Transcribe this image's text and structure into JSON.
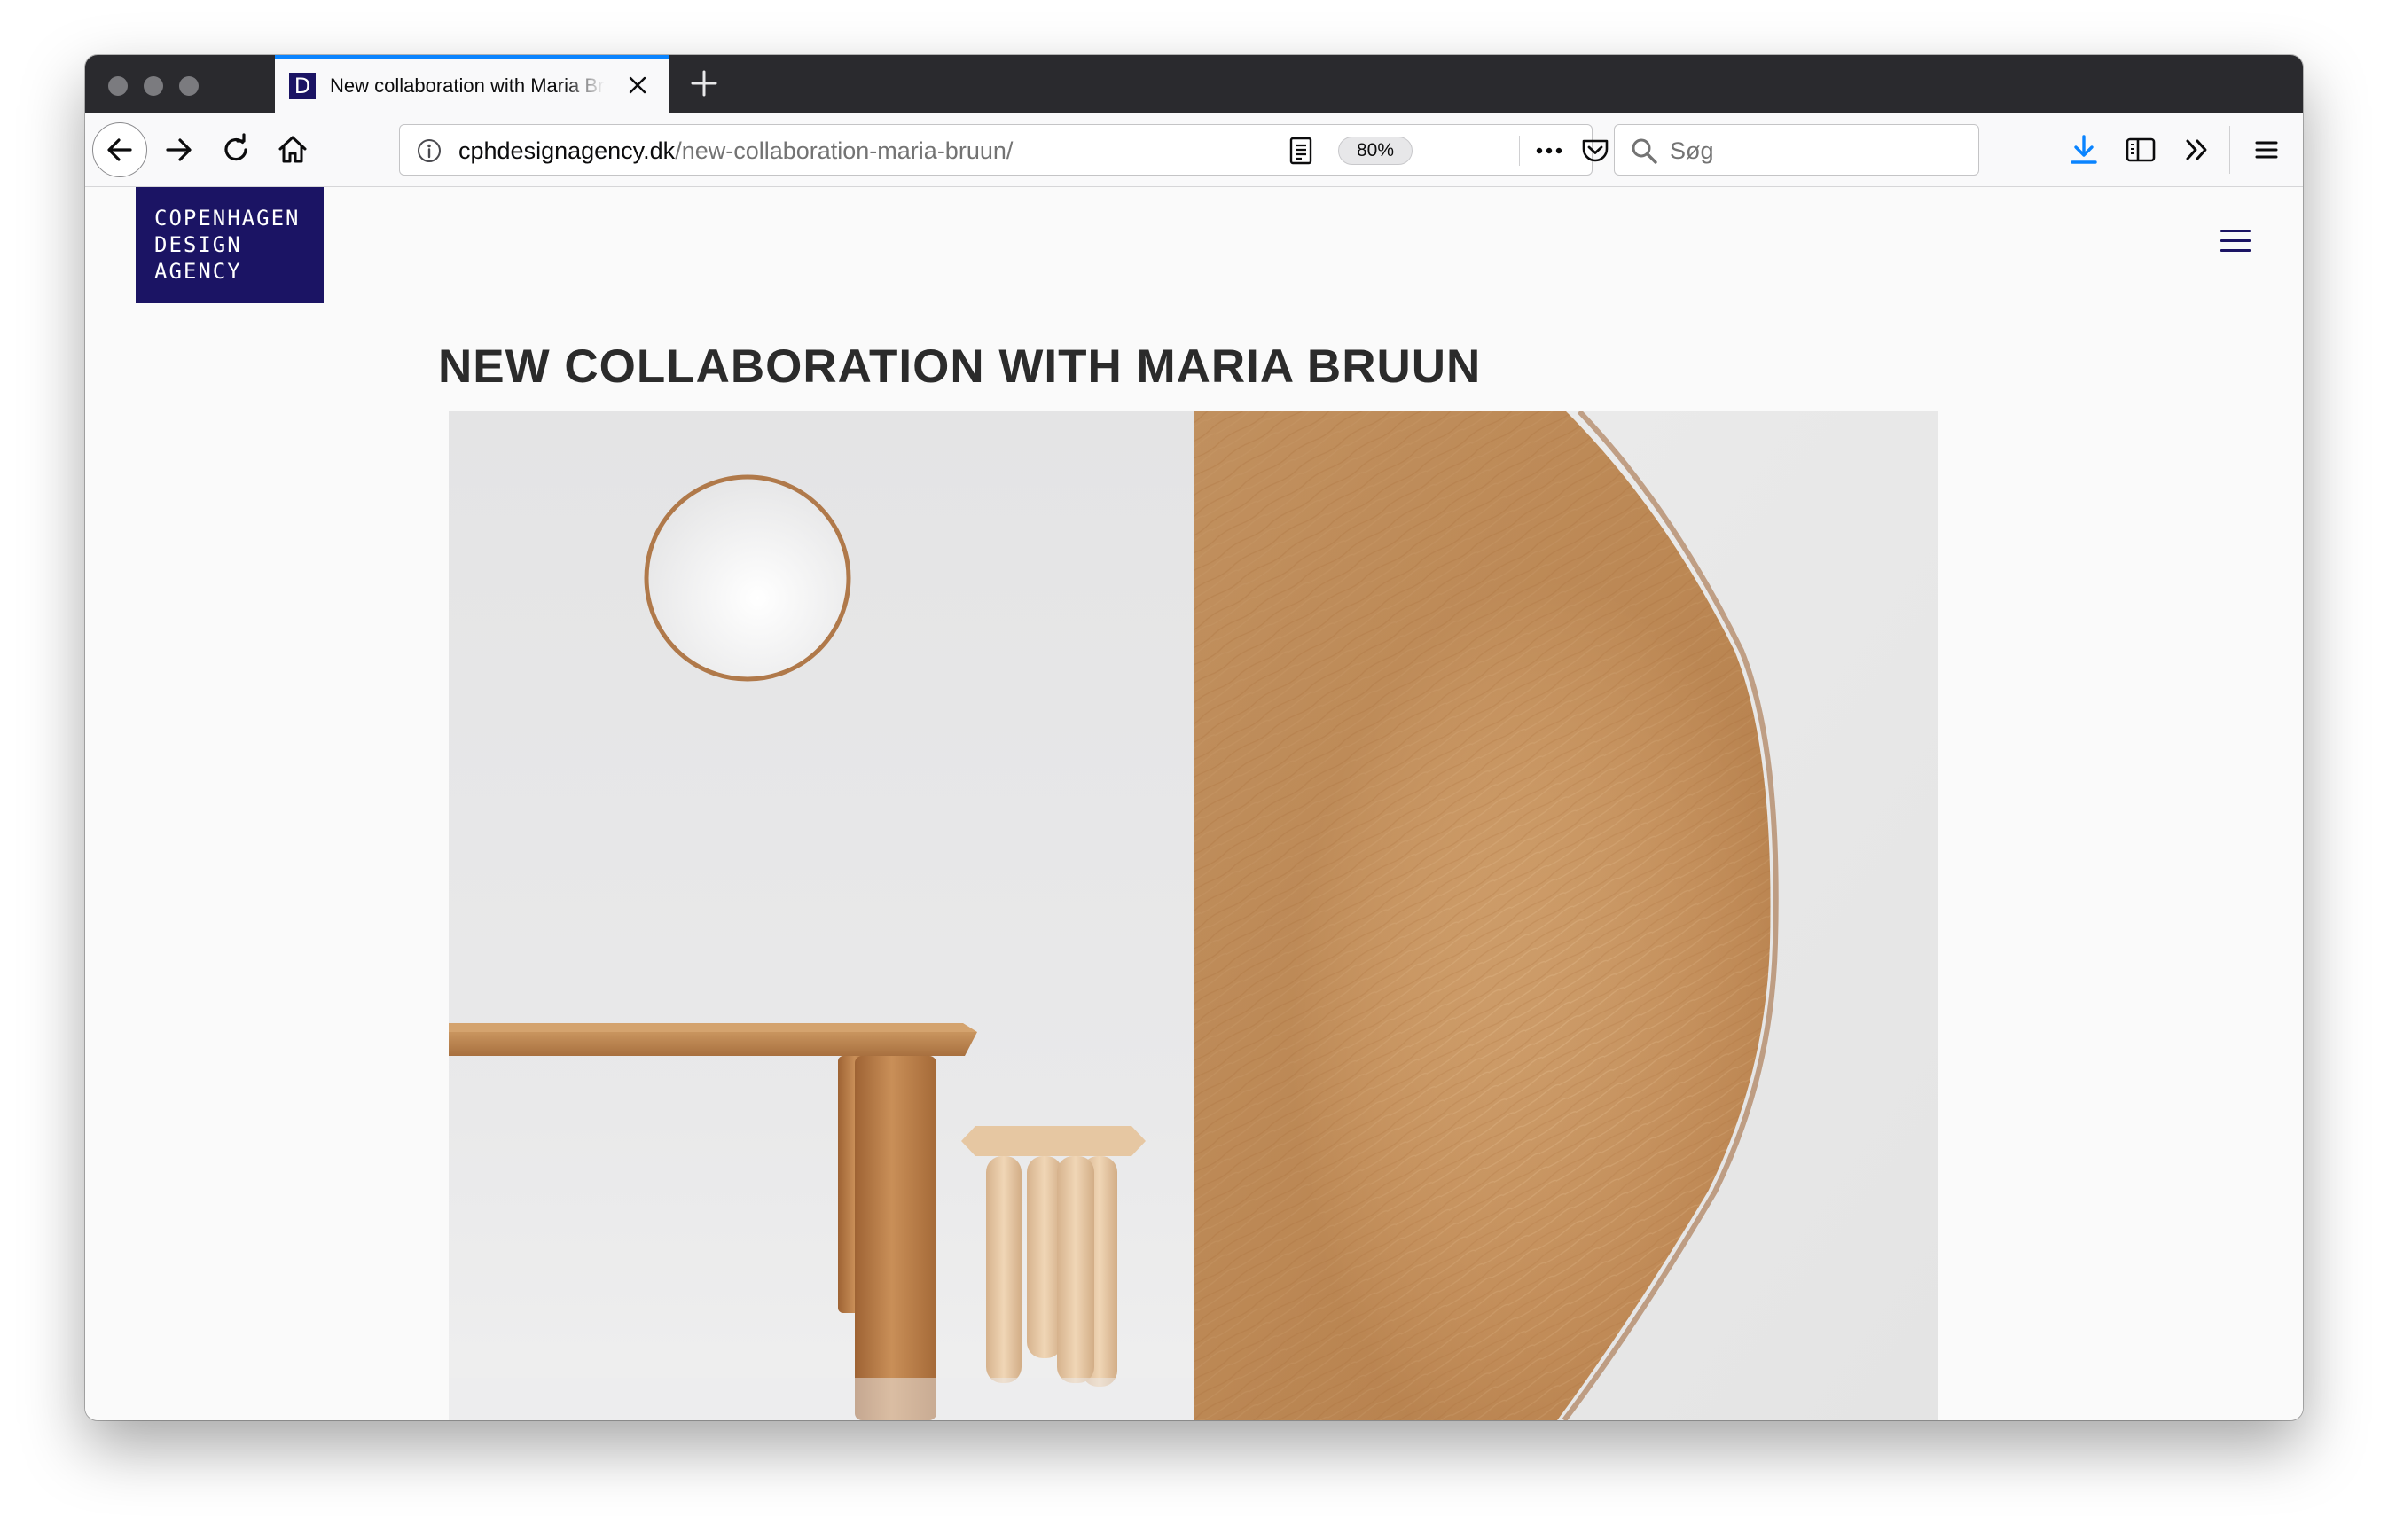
{
  "browser": {
    "tab": {
      "favicon_letter": "D",
      "title": "New collaboration with Maria Bruun",
      "active_color": "#0a84ff"
    },
    "url": {
      "domain": "cphdesignagency.dk",
      "path": "/new-collaboration-maria-bruun/"
    },
    "zoom_label": "80%",
    "search_placeholder": "Søg",
    "icons": [
      "back-arrow-icon",
      "forward-arrow-icon",
      "reload-icon",
      "home-icon",
      "info-icon",
      "reader-view-icon",
      "page-actions-icon",
      "pocket-icon",
      "bookmark-star-icon",
      "search-icon",
      "downloads-icon",
      "sidebar-icon",
      "overflow-chevron-icon",
      "menu-icon",
      "close-icon",
      "plus-icon"
    ]
  },
  "site": {
    "logo": {
      "line1": "COPENHAGEN",
      "line2": "DESIGN",
      "line3": "AGENCY"
    },
    "brand_color": "#1b1464",
    "article_title": "NEW COLLABORATION WITH MARIA BRUUN",
    "hero_image": "photo-wooden-table-stool-mirror-and-oak-closeup"
  }
}
